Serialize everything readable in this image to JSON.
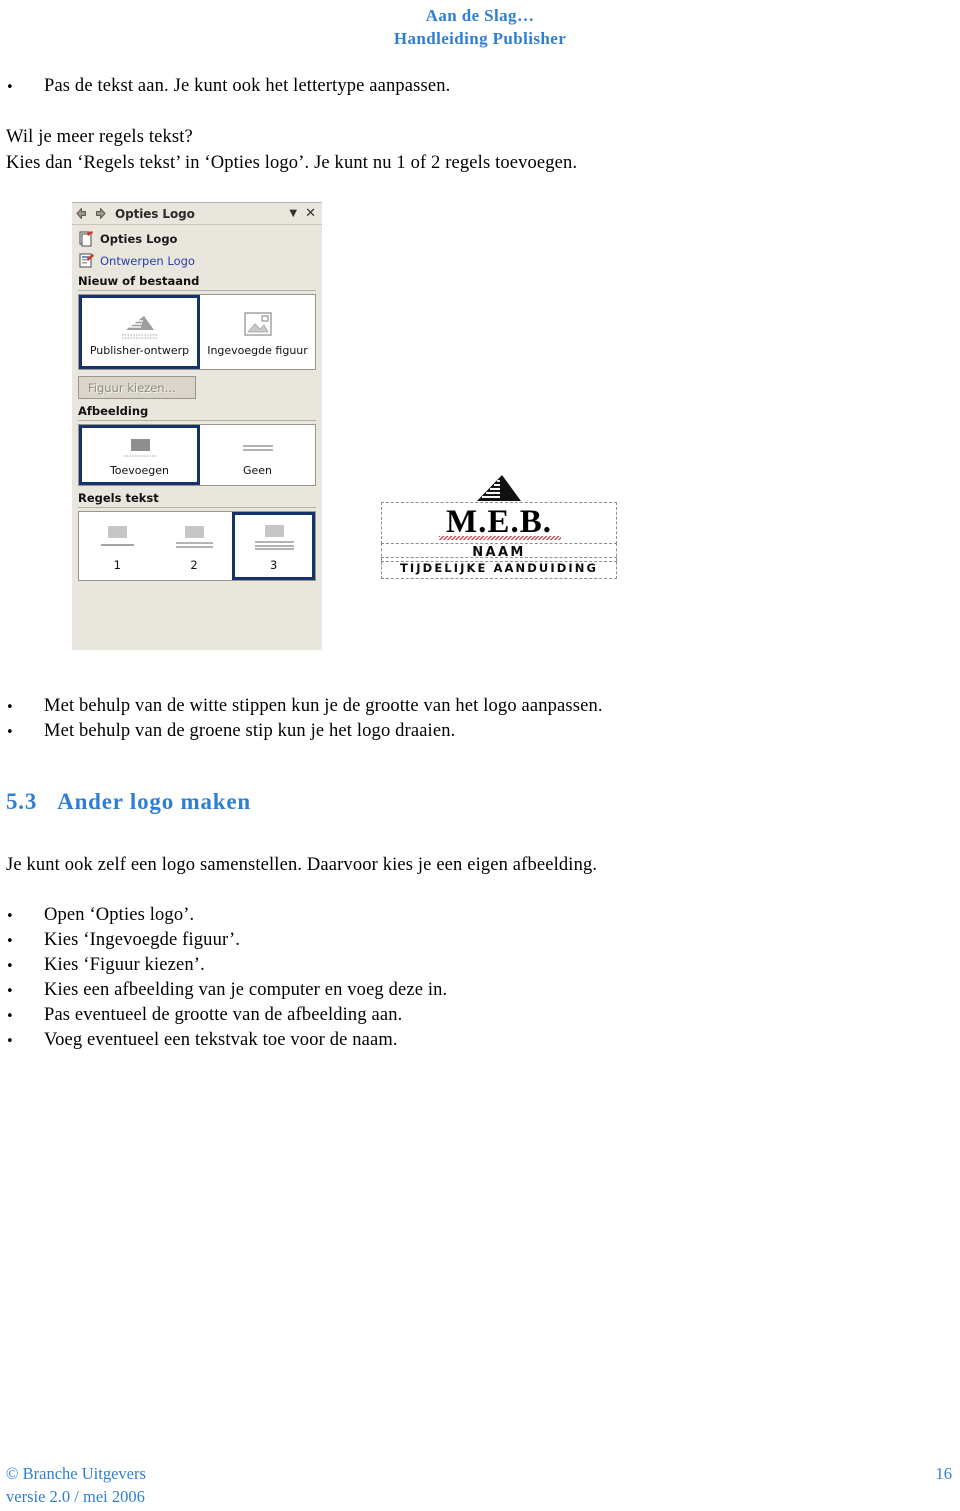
{
  "document": {
    "header_line1": "Aan de Slag…",
    "header_line2": "Handleiding Publisher",
    "bullet_top": "Pas de tekst aan. Je kunt ook het lettertype aanpassen.",
    "para_question": "Wil je meer regels tekst?",
    "para_answer": "Kies dan ‘Regels tekst’ in ‘Opties logo’. Je kunt nu 1 of 2 regels toevoegen.",
    "bullets_middle": [
      "Met behulp van de witte stippen kun je de grootte van het logo aanpassen.",
      "Met behulp van de groene stip kun je het logo draaien."
    ],
    "section": {
      "number": "5.3",
      "title": "Ander logo maken"
    },
    "para_intro": "Je kunt ook zelf een logo samenstellen. Daarvoor kies je een eigen afbeelding.",
    "bullets_bottom": [
      "Open ‘Opties logo’.",
      "Kies ‘Ingevoegde figuur’.",
      "Kies ‘Figuur kiezen’.",
      "Kies een afbeelding van je computer en voeg deze in.",
      "Pas eventueel de grootte van de afbeelding aan.",
      "Voeg eventueel een tekstvak toe voor de naam."
    ],
    "footer": {
      "copyright": "© Branche Uitgevers",
      "version": "versie 2.0 / mei 2006",
      "page_number": "16"
    },
    "colors": {
      "heading_blue": "#2e7fd4",
      "selection_blue": "#16326b",
      "link_blue": "#2a3fa5",
      "pane_background": "#e9e6de"
    }
  },
  "taskpane": {
    "title": "Opties Logo",
    "entries": [
      {
        "label": "Opties Logo",
        "icon": "logo-options-icon",
        "style": "bold"
      },
      {
        "label": "Ontwerpen Logo",
        "icon": "design-logo-icon",
        "style": "link"
      }
    ],
    "sections": [
      {
        "title": "Nieuw of bestaand",
        "options": [
          {
            "label": "Publisher-ontwerp",
            "selected": true,
            "icon": "publisher-design-thumb"
          },
          {
            "label": "Ingevoegde figuur",
            "selected": false,
            "icon": "inserted-picture-thumb"
          }
        ]
      },
      {
        "title": "Afbeelding",
        "options": [
          {
            "label": "Toevoegen",
            "selected": true,
            "icon": "add-picture-thumb"
          },
          {
            "label": "Geen",
            "selected": false,
            "icon": "no-picture-thumb"
          }
        ]
      },
      {
        "title": "Regels tekst",
        "options": [
          {
            "label": "1",
            "selected": false,
            "icon": "one-line-thumb"
          },
          {
            "label": "2",
            "selected": false,
            "icon": "two-lines-thumb"
          },
          {
            "label": "3",
            "selected": true,
            "icon": "three-lines-thumb"
          }
        ]
      }
    ],
    "choose_picture_button": "Figuur kiezen...",
    "choose_picture_enabled": false,
    "titlebar_icons": [
      "back-arrow-icon",
      "forward-arrow-icon",
      "chevron-down-icon",
      "close-icon"
    ]
  },
  "logo_graphic": {
    "mark": "triangle-logo-mark",
    "company": "M.E.B.",
    "name_line": "NAAM",
    "tagline_line": "TIJDELIJKE AANDUIDING"
  }
}
